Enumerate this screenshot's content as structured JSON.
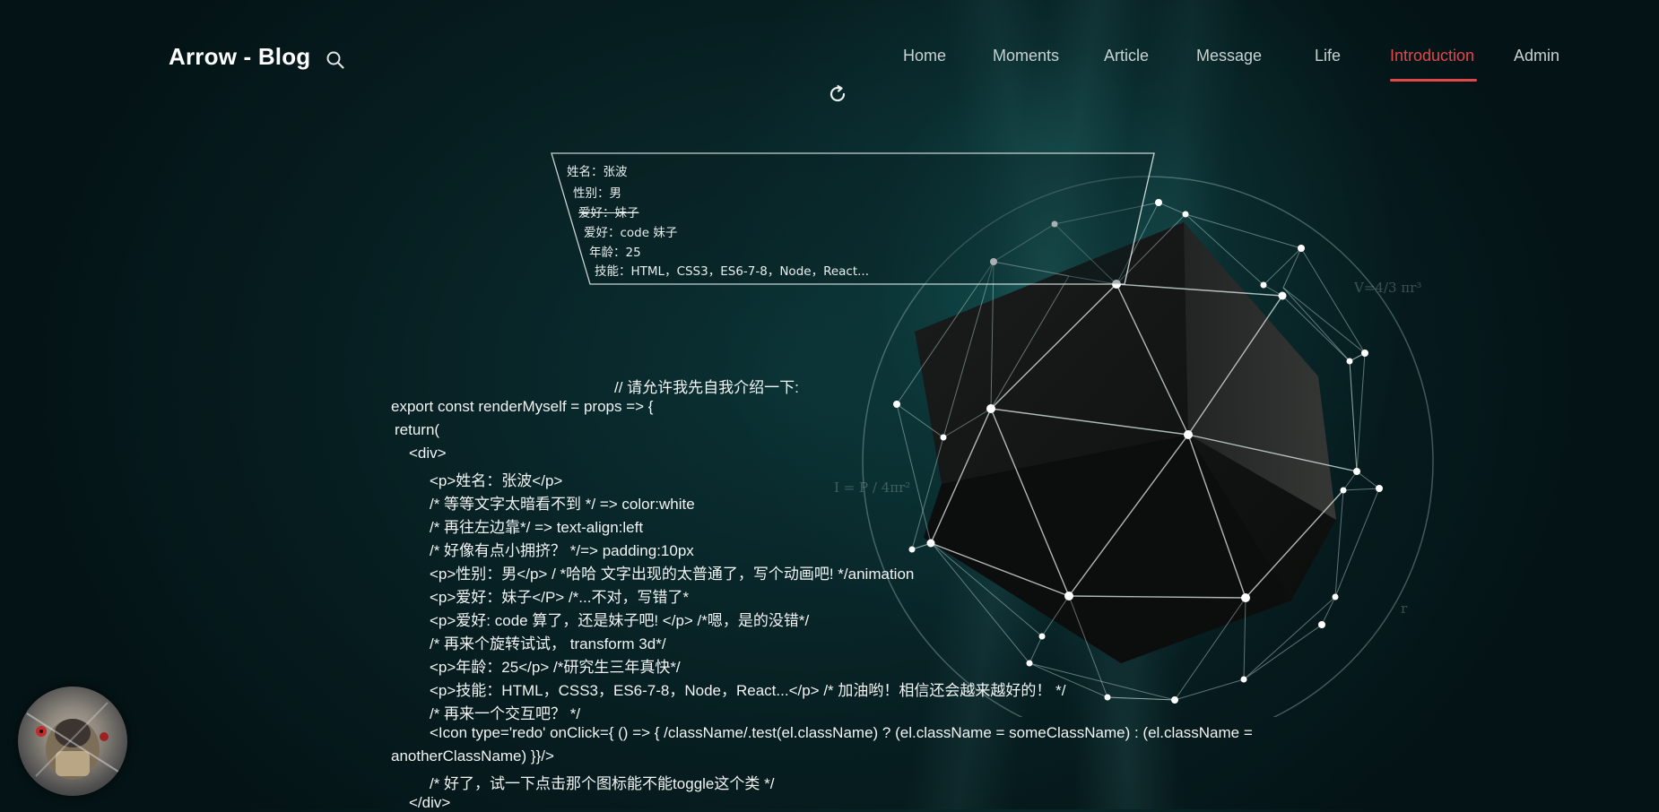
{
  "header": {
    "logo": "Arrow - Blog",
    "nav": [
      {
        "label": "Home"
      },
      {
        "label": "Moments"
      },
      {
        "label": "Article"
      },
      {
        "label": "Message"
      },
      {
        "label": "Life"
      },
      {
        "label": "Introduction",
        "active": true
      },
      {
        "label": "Admin"
      }
    ],
    "accent_color": "#e2474b"
  },
  "card": {
    "lines": [
      "姓名：张波",
      "性别：男",
      "爱好：妹子",
      "爱好：code 妹子",
      "年龄：25",
      "技能：HTML，CSS3，ES6-7-8，Node，React..."
    ]
  },
  "formulas": {
    "volume": "V=4/3 πr³",
    "intensity": "I = P / 4πr²",
    "radius": "r"
  },
  "code": {
    "lines": [
      "// 请允许我先自我介绍一下:",
      "export const renderMyself = props => {",
      "return(",
      "<div>",
      "<p>姓名：张波</p>",
      "/* 等等文字太暗看不到 */ => color:white",
      "/* 再往左边靠*/ => text-align:left",
      "/* 好像有点小拥挤？ */=> padding:10px",
      "<p>性别：男</p> / *哈哈   文字出现的太普通了，写个动画吧! */animation",
      "<p>爱好：妹子</P> /*...不对，写错了*",
      "<p>爱好: code 算了，还是妹子吧!   </p> /*嗯，是的没错*/",
      "/* 再来个旋转试试，  transform 3d*/",
      "<p>年龄：25</p> /*研究生三年真快*/",
      "<p>技能：HTML，CSS3，ES6-7-8，Node，React...</p> /* 加油哟！相信还会越来越好的！ */",
      "/* 再来一个交互吧？ */",
      "<Icon type='redo' onClick={ () => { /className/.test(el.className) ? (el.className = someClassName) :  (el.className =",
      "anotherClassName) }}/>",
      "/* 好了，试一下点击那个图标能不能toggle这个类 */",
      "</div>"
    ]
  },
  "icons": {
    "search": "search-icon",
    "reload": "redo-icon",
    "avatar": "avatar-image"
  }
}
